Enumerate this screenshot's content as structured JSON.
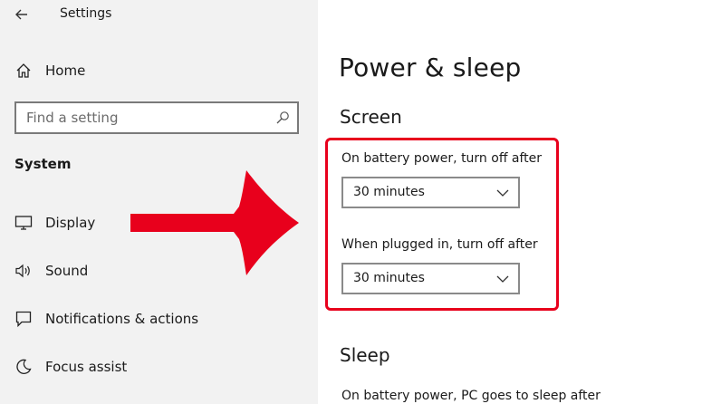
{
  "window": {
    "title": "Settings"
  },
  "sidebar": {
    "home_label": "Home",
    "search_placeholder": "Find a setting",
    "section_title": "System",
    "items": [
      {
        "label": "Display",
        "icon": "display-icon"
      },
      {
        "label": "Sound",
        "icon": "speaker-icon"
      },
      {
        "label": "Notifications & actions",
        "icon": "notification-icon"
      },
      {
        "label": "Focus assist",
        "icon": "moon-icon"
      }
    ]
  },
  "main": {
    "page_title": "Power & sleep",
    "screen": {
      "heading": "Screen",
      "battery_label": "On battery power, turn off after",
      "battery_value": "30 minutes",
      "plugged_label": "When plugged in, turn off after",
      "plugged_value": "30 minutes"
    },
    "sleep": {
      "heading": "Sleep",
      "battery_label": "On battery power, PC goes to sleep after"
    }
  },
  "colors": {
    "annotation_red": "#e8001c",
    "sidebar_bg": "#f2f2f2"
  }
}
